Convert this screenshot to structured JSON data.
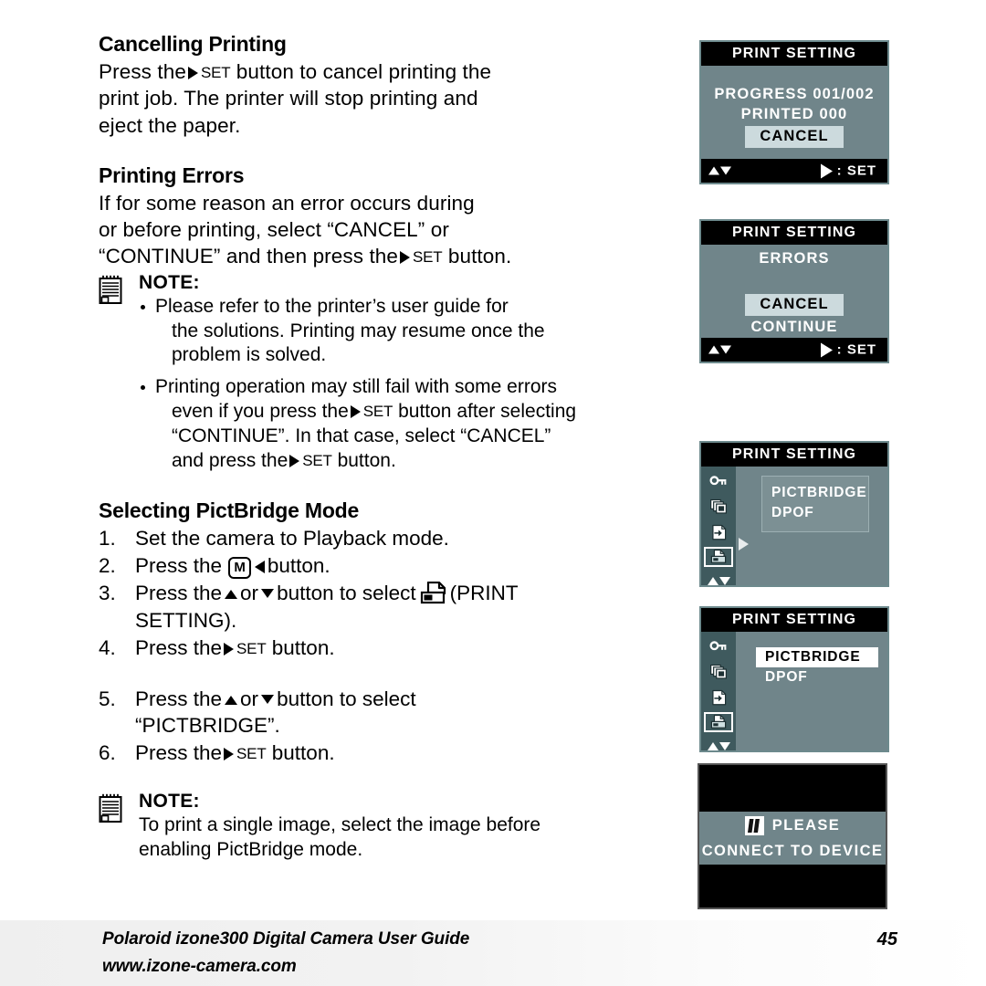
{
  "page": {
    "number": "45"
  },
  "sections": {
    "cancelling": {
      "heading": "Cancelling Printing",
      "line1_pre": "Press the",
      "set_label": "SET",
      "line1_post": "button to cancel printing the",
      "line2": "print job. The printer will stop printing and",
      "line3": "eject the paper."
    },
    "printing_errors": {
      "heading": "Printing Errors",
      "line1": "If for some reason an error occurs during",
      "line2": "or before printing, select “CANCEL” or",
      "line3_pre": "“CONTINUE” and then press the",
      "set_label": "SET",
      "line3_post": "button."
    },
    "note1": {
      "title": "NOTE:",
      "bullet1_l1": "Please  refer  to  the  printer’s  user  guide  for",
      "bullet1_l2": "the  solutions.  Printing  may  resume  once  the",
      "bullet1_l3": "problem is solved.",
      "bullet2_l1": "Printing operation may still fail with some errors",
      "bullet2_l2_pre": "even if you press the",
      "bullet2_set": "SET",
      "bullet2_l2_post": "button after selecting",
      "bullet2_l3": "“CONTINUE”.  In  that  case,  select  “CANCEL”",
      "bullet2_l4_pre": "and press the",
      "bullet2_set2": "SET",
      "bullet2_l4_post": "button."
    },
    "pictbridge": {
      "heading": "Selecting PictBridge Mode",
      "steps": [
        {
          "num": "1.",
          "text": "Set the camera to Playback mode."
        },
        {
          "num": "2.",
          "pre": "Press the",
          "mbtn": "M",
          "post": "button."
        },
        {
          "num": "3.",
          "pre": "Press the",
          "mid": "or",
          "post": "button to select",
          "paren_pre": "(PRINT",
          "line2": "SETTING)."
        },
        {
          "num": "4.",
          "pre": "Press the",
          "set": "SET",
          "post": "button."
        },
        {
          "num": "5.",
          "pre": "Press the",
          "mid": "or",
          "post": "button to select",
          "line2": "“PICTBRIDGE”."
        },
        {
          "num": "6.",
          "pre": "Press the",
          "set": "SET",
          "post": "button."
        }
      ]
    },
    "note2": {
      "title": "NOTE:",
      "line1": "To print a single image, select the image before",
      "line2": "enabling PictBridge mode."
    }
  },
  "lcd_screens": {
    "progress": {
      "title": "PRINT SETTING",
      "line1": "PROGRESS 001/002",
      "line2": "PRINTED 000",
      "selected": "CANCEL",
      "footer_set": ": SET"
    },
    "errors": {
      "title": "PRINT SETTING",
      "line1": "ERRORS",
      "selected": "CANCEL",
      "option2": "CONTINUE",
      "footer_set": ": SET"
    },
    "menu_unselected": {
      "title": "PRINT SETTING",
      "items": [
        "PICTBRIDGE",
        "DPOF"
      ],
      "side_icons": [
        "key-icon",
        "copies-icon",
        "transfer-icon",
        "printer-icon"
      ],
      "selected_side_icon": "printer-icon"
    },
    "menu_selected": {
      "title": "PRINT SETTING",
      "items": [
        "PICTBRIDGE",
        "DPOF"
      ],
      "highlighted": "PICTBRIDGE",
      "side_icons": [
        "key-icon",
        "copies-icon",
        "transfer-icon",
        "printer-icon"
      ],
      "selected_side_icon": "printer-icon"
    },
    "connect": {
      "logo": "pictbridge-logo",
      "line1": "PLEASE",
      "line2": "CONNECT TO DEVICE"
    }
  },
  "footer": {
    "title": "Polaroid izone300 Digital Camera User Guide",
    "url": "www.izone-camera.com",
    "page": "45"
  },
  "colors": {
    "lcd_bg": "#70858a",
    "lcd_bar": "#000000",
    "lcd_side": "#3f5a5e",
    "chip": "#ccdadd",
    "menu_box": "#7c9094"
  }
}
